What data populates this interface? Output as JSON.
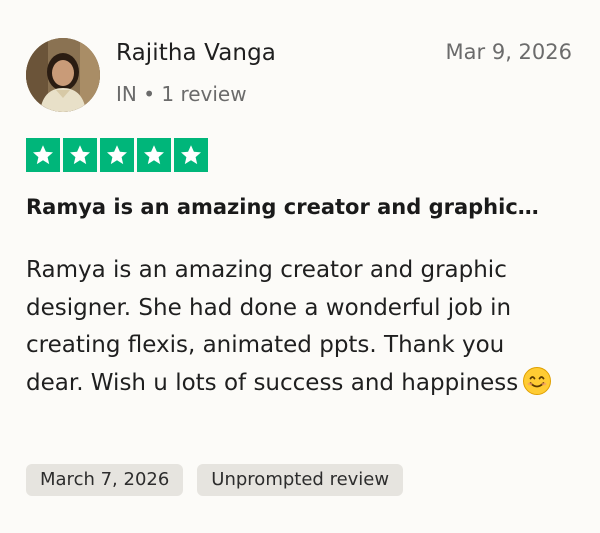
{
  "reviewer": {
    "name": "Rajitha Vanga",
    "meta": "IN • 1 review",
    "date": "Mar 9, 2026",
    "avatar_icon": "profile-photo"
  },
  "rating": {
    "stars": 5,
    "max": 5,
    "color": "#00b67a"
  },
  "review": {
    "title": "Ramya is an amazing creator and graphic…",
    "body": "Ramya is an amazing creator and graphic designer. She had done a wonderful job in creating flexis, animated ppts. Thank you dear. Wish u lots of success and happiness",
    "emoji": "smiling-face-emoji"
  },
  "tags": {
    "experience_date": "March 7, 2026",
    "review_type": "Unprompted review"
  }
}
